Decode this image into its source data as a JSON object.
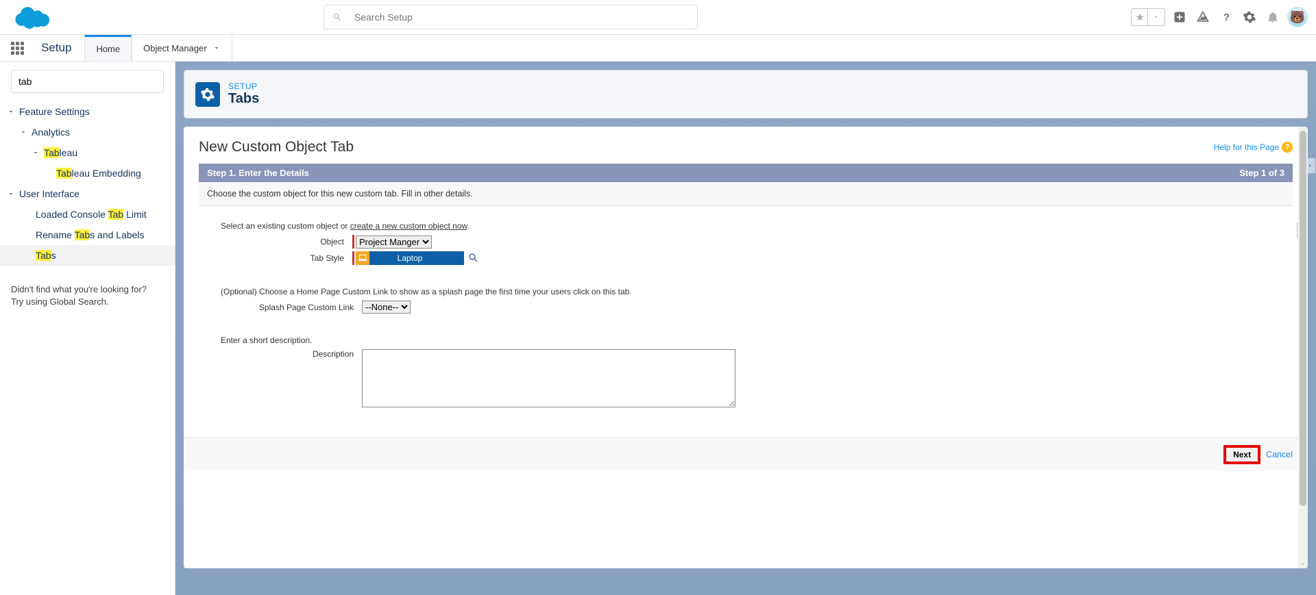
{
  "header": {
    "search_placeholder": "Search Setup"
  },
  "nav": {
    "setup_label": "Setup",
    "tabs": [
      {
        "label": "Home",
        "active": true
      },
      {
        "label": "Object Manager",
        "active": false
      }
    ]
  },
  "sidebar": {
    "quick_find_value": "tab",
    "tree": {
      "feature_settings": "Feature Settings",
      "analytics": "Analytics",
      "tableau_pre": "Tab",
      "tableau_post": "leau",
      "tableau_embed_pre": "Tab",
      "tableau_embed_post": "leau Embedding",
      "user_interface": "User Interface",
      "loaded_pre": "Loaded Console ",
      "loaded_hl": "Tab",
      "loaded_post": " Limit",
      "rename_pre": "Rename ",
      "rename_hl": "Tab",
      "rename_post": "s and Labels",
      "tabs_hl": "Tab",
      "tabs_post": "s"
    },
    "footer_line1": "Didn't find what you're looking for?",
    "footer_line2": "Try using Global Search."
  },
  "page": {
    "crumb": "SETUP",
    "title": "Tabs",
    "form_title": "New Custom Object Tab",
    "help_text": "Help for this Page",
    "step_title": "Step 1. Enter the Details",
    "step_counter": "Step 1 of 3",
    "step_desc": "Choose the custom object for this new custom tab. Fill in other details.",
    "intro_text": "Select an existing custom object or ",
    "intro_link": "create a new custom object now",
    "object_label": "Object",
    "object_value": "Project Manger",
    "tabstyle_label": "Tab Style",
    "tabstyle_value": "Laptop",
    "splash_intro": "(Optional) Choose a Home Page Custom Link to show as a splash page the first time your users click on this tab.",
    "splash_label": "Splash Page Custom Link",
    "splash_value": "--None--",
    "desc_intro": "Enter a short description.",
    "desc_label": "Description",
    "next_label": "Next",
    "cancel_label": "Cancel"
  }
}
